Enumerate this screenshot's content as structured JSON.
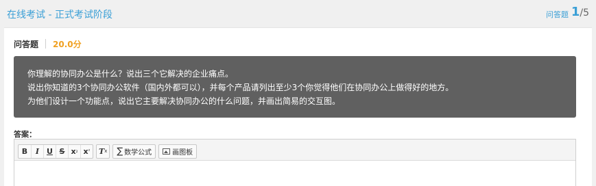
{
  "header": {
    "title": "在线考试 - 正式考试阶段",
    "question_type_label": "问答题",
    "current_question": "1",
    "total_questions": "/5"
  },
  "question": {
    "type_label": "问答题",
    "score": "20.0分",
    "lines": [
      "你理解的协同办公是什么？说出三个它解决的企业痛点。",
      "说出你知道的3个协同办公软件（国内外都可以），并每个产品请列出至少3个你觉得他们在协同办公上做得好的地方。",
      "为他们设计一个功能点，说出它主要解决协同办公的什么问题，并画出简易的交互图。"
    ]
  },
  "answer": {
    "label": "答案：",
    "toolbar": {
      "bold": "B",
      "italic": "I",
      "underline": "U",
      "strikethrough": "S",
      "subscript_base": "x",
      "subscript_mark": "₂",
      "superscript_base": "x",
      "superscript_mark": "²",
      "clear_format": "T",
      "clear_format_mark": "x",
      "math_symbol": "∑",
      "math_formula": "数学公式",
      "drawing_board": "画图板"
    }
  }
}
